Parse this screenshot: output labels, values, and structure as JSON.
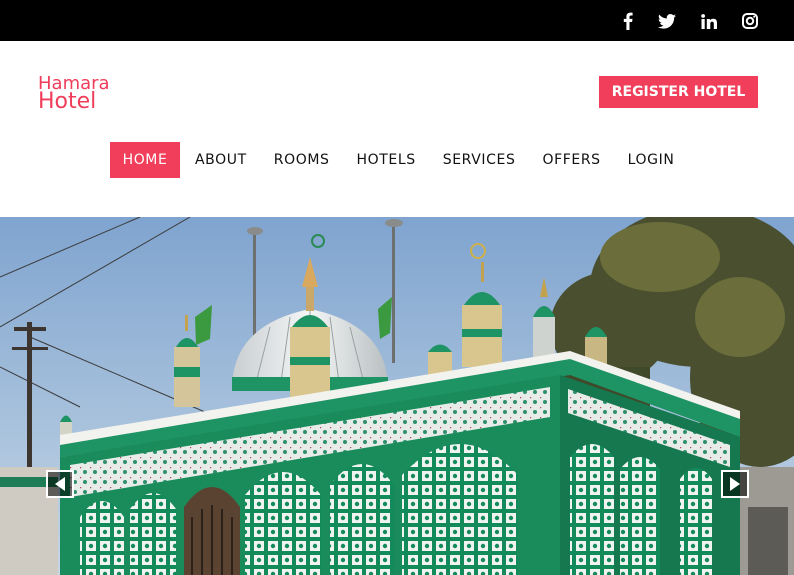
{
  "social": [
    {
      "name": "facebook",
      "glyph": "f"
    },
    {
      "name": "twitter",
      "glyph": "twitter"
    },
    {
      "name": "linkedin",
      "glyph": "in"
    },
    {
      "name": "instagram",
      "glyph": "instagram"
    }
  ],
  "brand": {
    "line1": "Hamara",
    "line2": "Hotel",
    "color": "#ef3d5a"
  },
  "header": {
    "register_label": "REGISTER HOTEL",
    "accent": "#f13f5b"
  },
  "nav": {
    "items": [
      "HOME",
      "ABOUT",
      "ROOMS",
      "HOTELS",
      "SERVICES",
      "OFFERS",
      "LOGIN"
    ],
    "active": "HOME"
  },
  "hero": {
    "subject": "green and white mosque photo",
    "controls": {
      "prev_icon": "chevron-left-icon",
      "next_icon": "chevron-right-icon"
    }
  }
}
